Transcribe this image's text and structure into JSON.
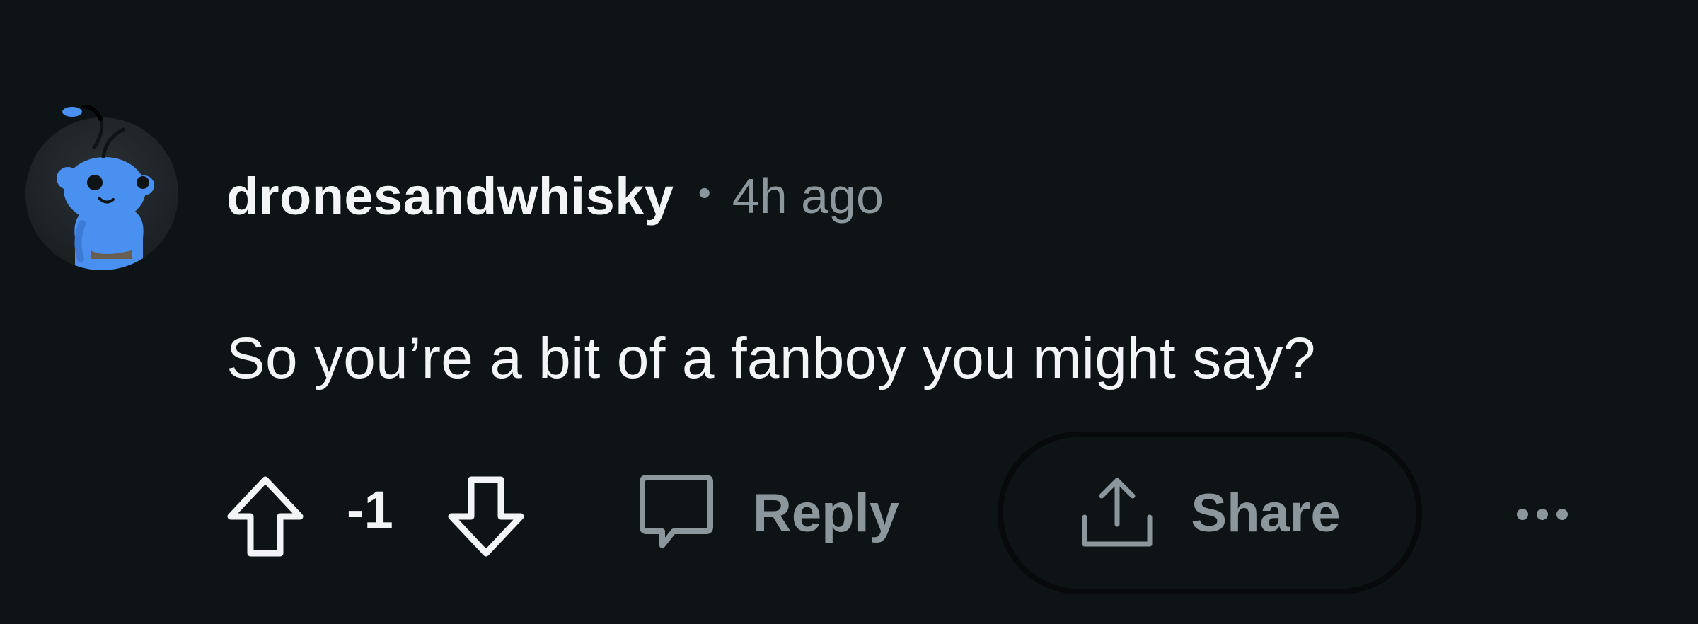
{
  "comment": {
    "username": "dronesandwhisky",
    "separator": "•",
    "timestamp": "4h ago",
    "body": "So you’re a bit of a fanboy you might say?"
  },
  "actions": {
    "score": "-1",
    "reply_label": "Reply",
    "share_label": "Share",
    "upvote_icon": "upvote-arrow-icon",
    "downvote_icon": "downvote-arrow-icon",
    "reply_icon": "speech-bubble-icon",
    "share_icon": "share-upload-icon",
    "more_icon": "ellipsis-icon"
  },
  "colors": {
    "background": "#0e1416",
    "text_primary": "#f2f4f5",
    "text_secondary": "#8b979d",
    "avatar_blue": "#4a90f0"
  }
}
